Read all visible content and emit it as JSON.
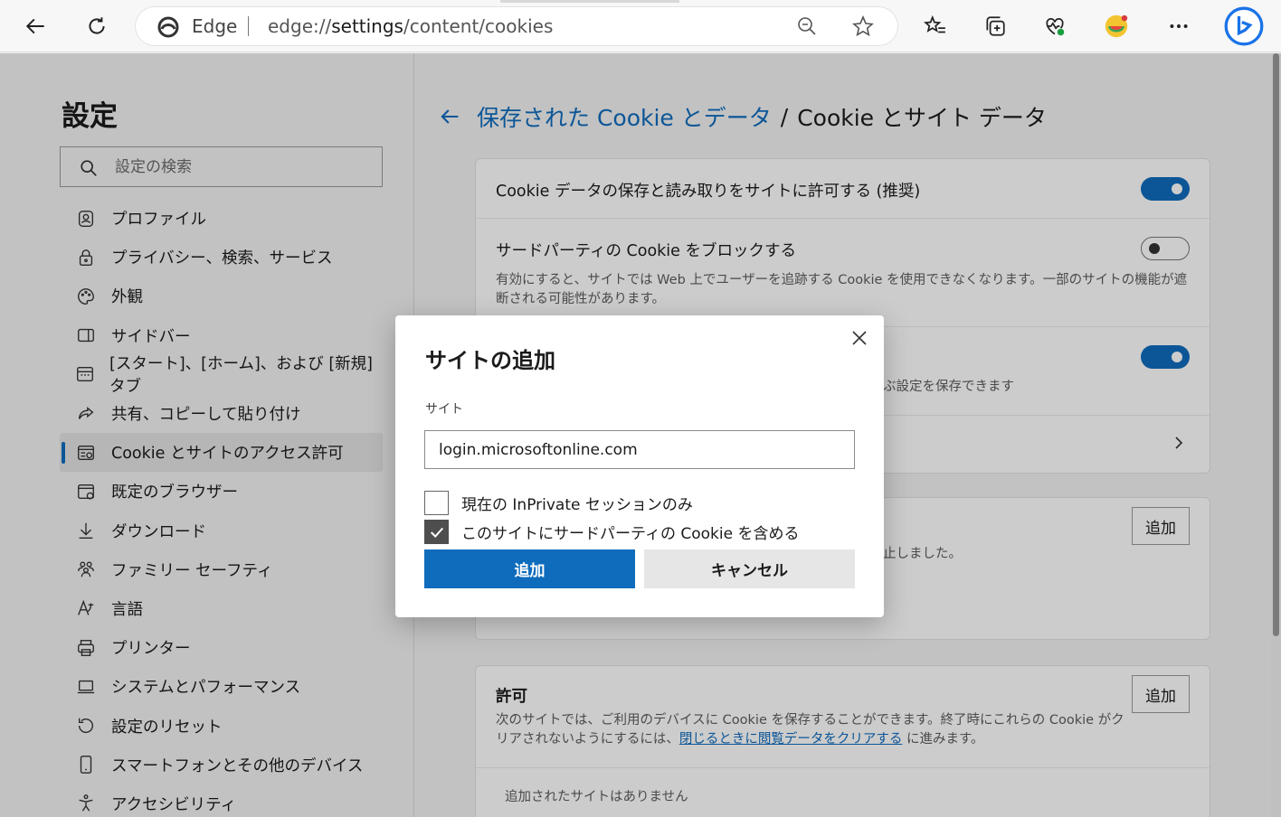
{
  "browser": {
    "brand": "Edge",
    "url_prefix": "edge://",
    "url_host": "settings",
    "url_path": "/content/cookies"
  },
  "sidebar": {
    "title": "設定",
    "search_placeholder": "設定の検索",
    "items": [
      {
        "label": "プロファイル",
        "icon": "profile-icon"
      },
      {
        "label": "プライバシー、検索、サービス",
        "icon": "lock-icon"
      },
      {
        "label": "外観",
        "icon": "palette-icon"
      },
      {
        "label": "サイドバー",
        "icon": "sidebar-icon"
      },
      {
        "label": "[スタート]、[ホーム]、および [新規] タブ",
        "icon": "home-tabs-icon"
      },
      {
        "label": "共有、コピーして貼り付け",
        "icon": "share-icon"
      },
      {
        "label": "Cookie とサイトのアクセス許可",
        "icon": "cookie-permissions-icon",
        "active": true
      },
      {
        "label": "既定のブラウザー",
        "icon": "default-browser-icon"
      },
      {
        "label": "ダウンロード",
        "icon": "download-icon"
      },
      {
        "label": "ファミリー セーフティ",
        "icon": "family-icon"
      },
      {
        "label": "言語",
        "icon": "language-icon"
      },
      {
        "label": "プリンター",
        "icon": "printer-icon"
      },
      {
        "label": "システムとパフォーマンス",
        "icon": "laptop-icon"
      },
      {
        "label": "設定のリセット",
        "icon": "reset-icon"
      },
      {
        "label": "スマートフォンとその他のデバイス",
        "icon": "phone-icon"
      },
      {
        "label": "アクセシビリティ",
        "icon": "accessibility-icon"
      }
    ]
  },
  "main": {
    "breadcrumb_link": "保存された Cookie とデータ",
    "breadcrumb_sep": "/",
    "breadcrumb_current": "Cookie とサイト データ",
    "allow_cookies_title": "Cookie データの保存と読み取りをサイトに許可する (推奨)",
    "allow_cookies_on": true,
    "block_third_party_title": "サードパーティの Cookie をブロックする",
    "block_third_party_desc": "有効にすると、サイトでは Web 上でユーザーを追跡する Cookie を使用できなくなります。一部のサイトの機能が遮断される可能性があります。",
    "block_third_party_on": false,
    "preload_toggle_on": true,
    "preload_desc_fragment": "ぶ設定を保存できます",
    "block_add_label": "追加",
    "block_desc_fragment": "止しました。",
    "allow_section_title": "許可",
    "allow_section_desc_1": "次のサイトでは、ご利用のデバイスに Cookie を保存することができます。終了時にこれらの Cookie がクリアされないようにするには、",
    "allow_section_link": "閉じるときに閲覧データをクリアする",
    "allow_section_desc_2": " に進みます。",
    "allow_add_label": "追加",
    "no_sites_text": "追加されたサイトはありません"
  },
  "dialog": {
    "title": "サイトの追加",
    "field_label": "サイト",
    "field_value": "login.microsoftonline.com",
    "checkbox1_label": "現在の InPrivate セッションのみ",
    "checkbox1_checked": false,
    "checkbox2_label": "このサイトにサードパーティの Cookie を含める",
    "checkbox2_checked": true,
    "primary_label": "追加",
    "secondary_label": "キャンセル"
  },
  "colors": {
    "accent": "#0f6cbd"
  }
}
